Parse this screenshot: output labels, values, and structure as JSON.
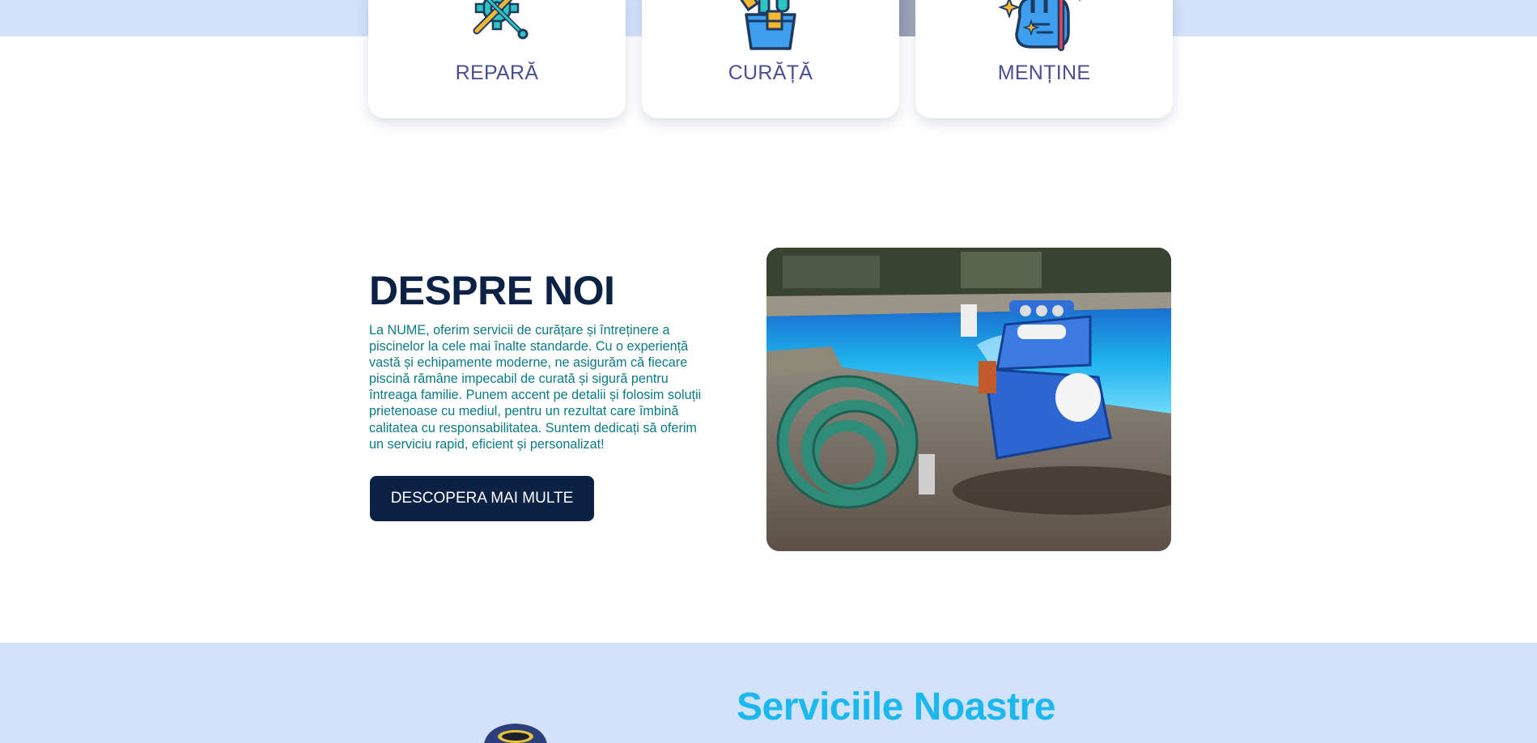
{
  "feature_cards": [
    {
      "label": "REPARĂ",
      "icon": "wrench-gear-icon"
    },
    {
      "label": "CURĂȚĂ",
      "icon": "cleaning-bucket-icon"
    },
    {
      "label": "MENȚINE",
      "icon": "sparkling-glove-icon"
    }
  ],
  "about": {
    "title": "DESPRE NOI",
    "text_lines": [
      "La NUME, oferim servicii de curățare și întreținere a",
      "piscinelor la cele mai înalte standarde. Cu o experiență",
      "vastă și echipamente moderne, ne asigurăm că fiecare",
      "piscină rămâne impecabil de curată și sigură pentru",
      "întreaga familie. Punem accent pe detalii și folosim soluții",
      "prietenoase cu mediul, pentru un rezultat care îmbină",
      "calitatea cu responsabilitatea. Suntem dedicați să oferim",
      "un serviciu rapid, eficient și personalizat!"
    ],
    "button_label": "DESCOPERA MAI MULTE",
    "photo": "pool-cleaning-equipment-photo"
  },
  "services": {
    "title": "Serviciile Noastre"
  },
  "colors": {
    "band": "#d3e2fb",
    "navy": "#0b2245",
    "teal_text": "#0a7a84",
    "card_label": "#4a4f94",
    "services_title": "#1bb8ee"
  }
}
